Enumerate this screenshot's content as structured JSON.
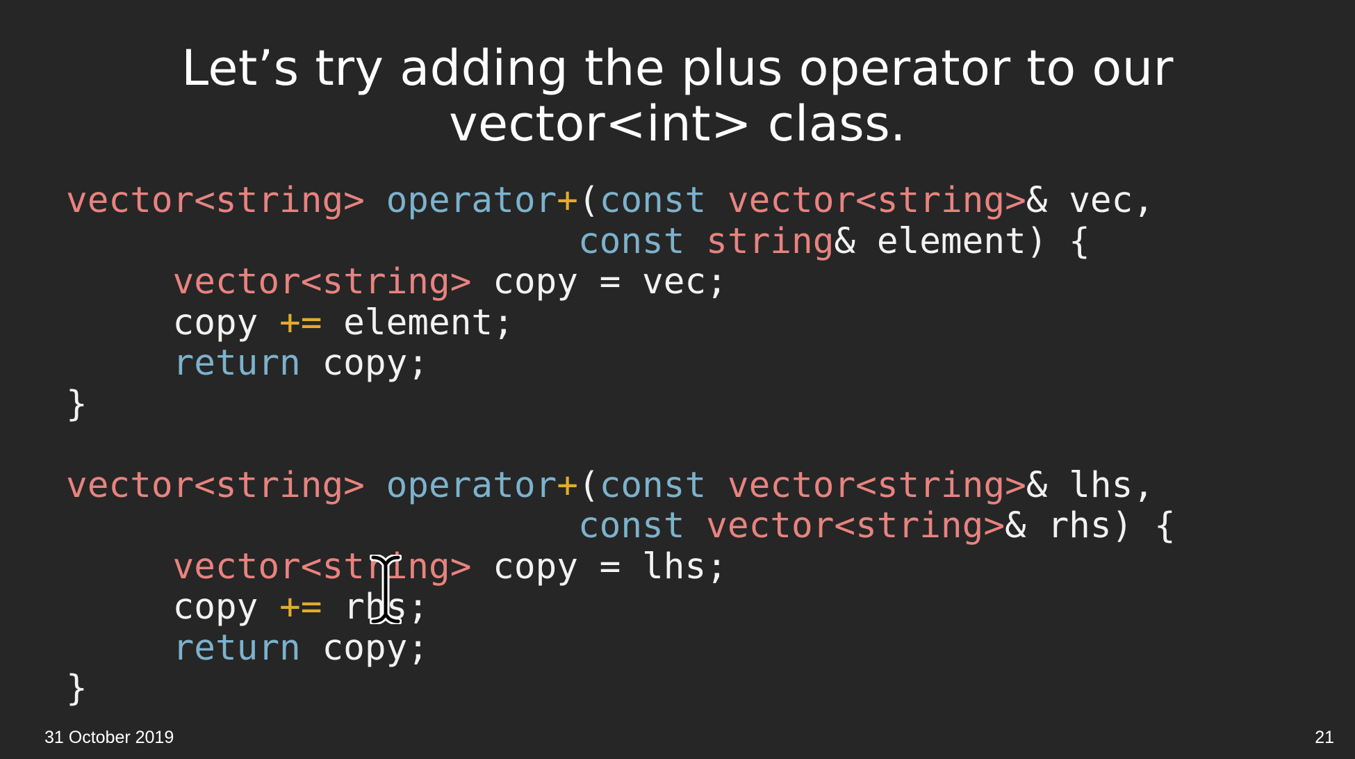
{
  "slide": {
    "title_line1": "Let’s try adding the plus operator to our",
    "title_line2": "vector<int> class.",
    "footer_date": "31 October 2019",
    "page_number": "21"
  },
  "colors": {
    "background": "#262626",
    "text": "#f2f2f2",
    "type_color": "#e8837f",
    "keyword_color": "#7cb2cc",
    "operator_color": "#e3ab2c"
  },
  "code_lines": [
    [
      [
        "type",
        "vector<string>"
      ],
      [
        "plain",
        " "
      ],
      [
        "kw",
        "operator"
      ],
      [
        "op",
        "+"
      ],
      [
        "plain",
        "("
      ],
      [
        "kw",
        "const"
      ],
      [
        "plain",
        " "
      ],
      [
        "type",
        "vector<string>"
      ],
      [
        "plain",
        "& vec,"
      ]
    ],
    [
      [
        "plain",
        "                        "
      ],
      [
        "kw",
        "const"
      ],
      [
        "plain",
        " "
      ],
      [
        "type",
        "string"
      ],
      [
        "plain",
        "& element) {"
      ]
    ],
    [
      [
        "plain",
        "     "
      ],
      [
        "type",
        "vector<string>"
      ],
      [
        "plain",
        " copy = vec;"
      ]
    ],
    [
      [
        "plain",
        "     copy "
      ],
      [
        "op",
        "+="
      ],
      [
        "plain",
        " element;"
      ]
    ],
    [
      [
        "plain",
        "     "
      ],
      [
        "kw",
        "return"
      ],
      [
        "plain",
        " copy;"
      ]
    ],
    [
      [
        "plain",
        "}"
      ]
    ],
    [
      [
        "plain",
        ""
      ]
    ],
    [
      [
        "type",
        "vector<string>"
      ],
      [
        "plain",
        " "
      ],
      [
        "kw",
        "operator"
      ],
      [
        "op",
        "+"
      ],
      [
        "plain",
        "("
      ],
      [
        "kw",
        "const"
      ],
      [
        "plain",
        " "
      ],
      [
        "type",
        "vector<string>"
      ],
      [
        "plain",
        "& lhs,"
      ]
    ],
    [
      [
        "plain",
        "                        "
      ],
      [
        "kw",
        "const"
      ],
      [
        "plain",
        " "
      ],
      [
        "type",
        "vector<string>"
      ],
      [
        "plain",
        "& rhs) {"
      ]
    ],
    [
      [
        "plain",
        "     "
      ],
      [
        "type",
        "vector<string>"
      ],
      [
        "plain",
        " copy = lhs;"
      ]
    ],
    [
      [
        "plain",
        "     copy "
      ],
      [
        "op",
        "+="
      ],
      [
        "plain",
        " rhs;"
      ]
    ],
    [
      [
        "plain",
        "     "
      ],
      [
        "kw",
        "return"
      ],
      [
        "plain",
        " copy;"
      ]
    ],
    [
      [
        "plain",
        "}"
      ]
    ]
  ],
  "icons": {
    "cursor": "i-beam-text-cursor-icon"
  }
}
